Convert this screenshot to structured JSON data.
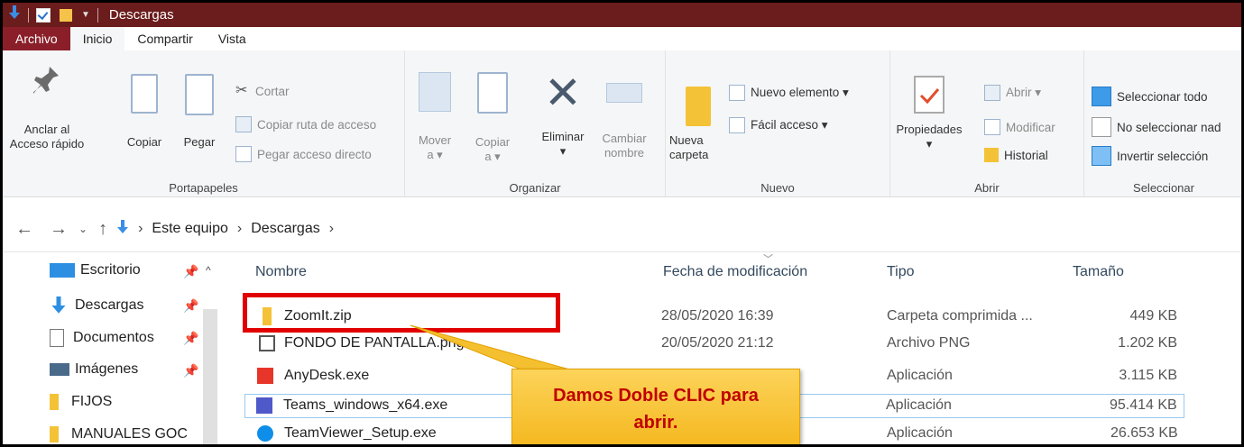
{
  "titlebar": {
    "title": "Descargas"
  },
  "tabs": [
    {
      "label": "Archivo"
    },
    {
      "label": "Inicio"
    },
    {
      "label": "Compartir"
    },
    {
      "label": "Vista"
    }
  ],
  "ribbon": {
    "portapapeles": {
      "label": "Portapapeles",
      "anclar": "Anclar al\nAcceso rápido",
      "copiar": "Copiar",
      "pegar": "Pegar",
      "cortar": "Cortar",
      "copiar_ruta": "Copiar ruta de acceso",
      "pegar_acceso": "Pegar acceso directo"
    },
    "organizar": {
      "label": "Organizar",
      "mover": "Mover\na ▾",
      "copiar_a": "Copiar\na ▾",
      "eliminar": "Eliminar\n▾",
      "cambiar": "Cambiar\nnombre"
    },
    "nuevo": {
      "label": "Nuevo",
      "nueva_carpeta": "Nueva\ncarpeta",
      "nuevo_elemento": "Nuevo elemento ▾",
      "facil_acceso": "Fácil acceso ▾"
    },
    "abrir": {
      "label": "Abrir",
      "propiedades": "Propiedades\n▾",
      "abrir": "Abrir ▾",
      "modificar": "Modificar",
      "historial": "Historial"
    },
    "seleccionar": {
      "label": "Seleccionar",
      "todo": "Seleccionar todo",
      "ninguno": "No seleccionar nad",
      "invertir": "Invertir selección"
    }
  },
  "address": {
    "crumb1": "Este equipo",
    "crumb2": "Descargas"
  },
  "navpane": [
    {
      "label": "Escritorio",
      "icon": "desktop-icon",
      "pinned": true
    },
    {
      "label": "Descargas",
      "icon": "download-icon",
      "pinned": true
    },
    {
      "label": "Documentos",
      "icon": "documents-icon",
      "pinned": true
    },
    {
      "label": "Imágenes",
      "icon": "pictures-icon",
      "pinned": true
    },
    {
      "label": "FIJOS",
      "icon": "folder-icon",
      "pinned": false
    },
    {
      "label": "MANUALES GOC",
      "icon": "folder-icon",
      "pinned": false
    }
  ],
  "columns": {
    "name": "Nombre",
    "date": "Fecha de modificación",
    "type": "Tipo",
    "size": "Tamaño"
  },
  "files": [
    {
      "name": "ZoomIt.zip",
      "date": "28/05/2020 16:39",
      "type": "Carpeta comprimida ...",
      "size": "449 KB",
      "icon": "zip-icon"
    },
    {
      "name": "FONDO DE PANTALLA.png",
      "date": "20/05/2020 21:12",
      "type": "Archivo PNG",
      "size": "1.202 KB",
      "icon": "image-file-icon"
    },
    {
      "name": "AnyDesk.exe",
      "date": "",
      "type": "Aplicación",
      "size": "3.115 KB",
      "icon": "anydesk-icon"
    },
    {
      "name": "Teams_windows_x64.exe",
      "date": "",
      "type": "Aplicación",
      "size": "95.414 KB",
      "icon": "teams-icon"
    },
    {
      "name": "TeamViewer_Setup.exe",
      "date": "",
      "type": "Aplicación",
      "size": "26.653 KB",
      "icon": "teamviewer-icon"
    }
  ],
  "annotation": {
    "line1": "Damos Doble CLIC para",
    "line2": "abrir."
  }
}
